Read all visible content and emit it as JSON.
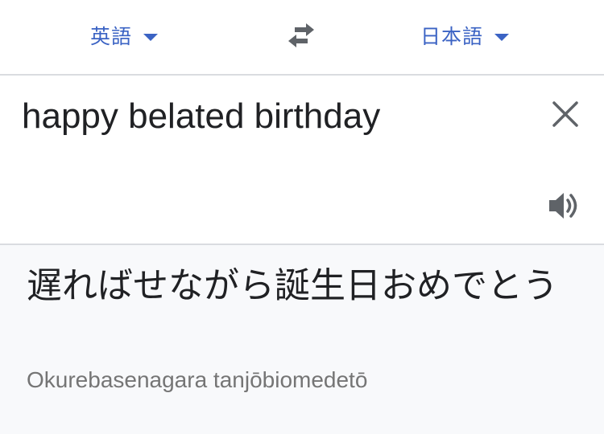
{
  "language_bar": {
    "source_language": "英語",
    "target_language": "日本語",
    "swap_icon": "swap-arrows-icon"
  },
  "input": {
    "text": "happy belated birthday",
    "clear_icon": "close-icon",
    "speaker_icon": "speaker-icon"
  },
  "output": {
    "translation": "遅ればせながら誕生日おめでとう",
    "romanization": "Okurebasenagara tanjōbiomedetō"
  },
  "colors": {
    "accent": "#3b63c4",
    "text": "#202124",
    "muted": "#757575",
    "icon": "#5f6368",
    "output_bg": "#f8f9fb",
    "divider": "#dadce0"
  }
}
